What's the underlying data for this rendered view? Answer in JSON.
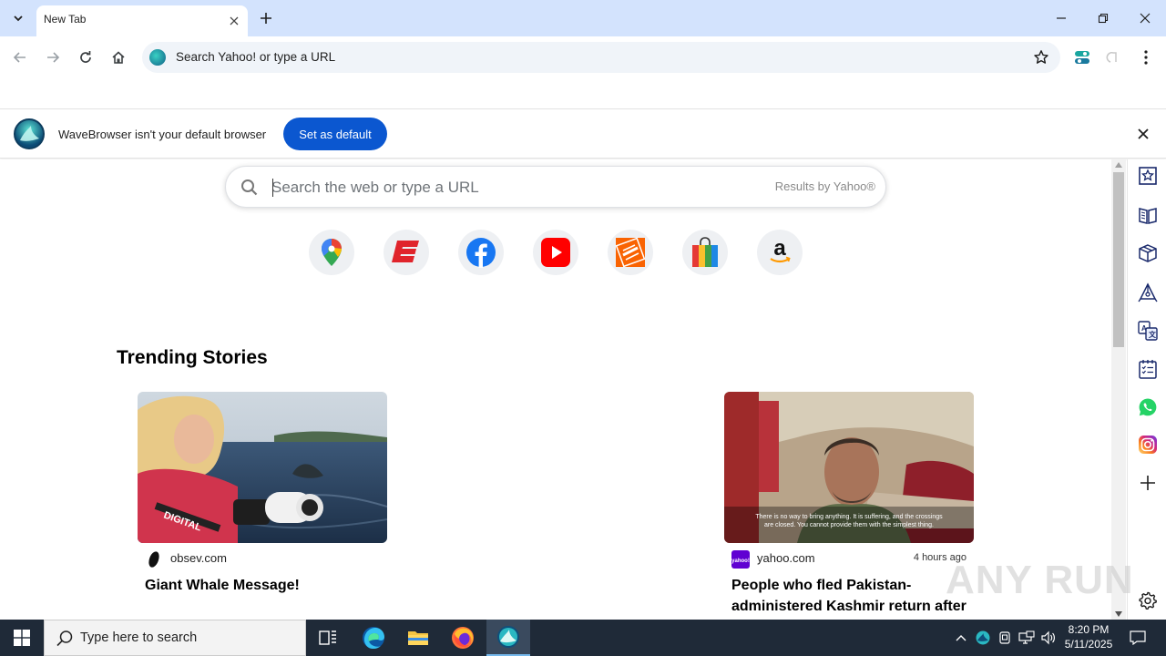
{
  "window": {
    "tab_title": "New Tab",
    "omnibox_placeholder": "Search Yahoo! or type a URL"
  },
  "infobar": {
    "message": "WaveBrowser isn't your default browser",
    "button_label": "Set as default"
  },
  "search": {
    "placeholder": "Search the web or type a URL",
    "results_by": "Results by Yahoo®"
  },
  "shortcuts": [
    {
      "name": "Google Maps",
      "icon": "maps-pin-icon"
    },
    {
      "name": "ESPN",
      "icon": "espn-icon"
    },
    {
      "name": "Facebook",
      "icon": "facebook-icon"
    },
    {
      "name": "YouTube",
      "icon": "youtube-icon"
    },
    {
      "name": "The Home Depot",
      "icon": "home-depot-icon"
    },
    {
      "name": "Shopping",
      "icon": "shopping-bag-icon"
    },
    {
      "name": "Amazon",
      "icon": "amazon-icon"
    }
  ],
  "trending": {
    "title": "Trending Stories",
    "stories": [
      {
        "source": "obsev.com",
        "time": "",
        "headline": "Giant Whale Message!"
      },
      {
        "source": "yahoo.com",
        "time": "4 hours ago",
        "headline": "People who fled Pakistan-administered Kashmir return after"
      }
    ],
    "caption_overlay": "There is no way to bring anything. It is suffering, and the crossings are closed. You cannot provide them with the simplest thing."
  },
  "sidebar_icons": [
    "bookmark-icon",
    "reader-icon",
    "box-icon",
    "pen-tool-icon",
    "translate-icon",
    "checklist-icon",
    "whatsapp-icon",
    "instagram-icon",
    "add-icon",
    "settings-icon"
  ],
  "watermark": "ANY RUN",
  "taskbar": {
    "search_placeholder": "Type here to search",
    "time": "8:20 PM",
    "date": "5/11/2025"
  },
  "colors": {
    "tabstrip": "#d3e3fd",
    "accent": "#0b57d0",
    "taskbar": "#1f2a38"
  }
}
